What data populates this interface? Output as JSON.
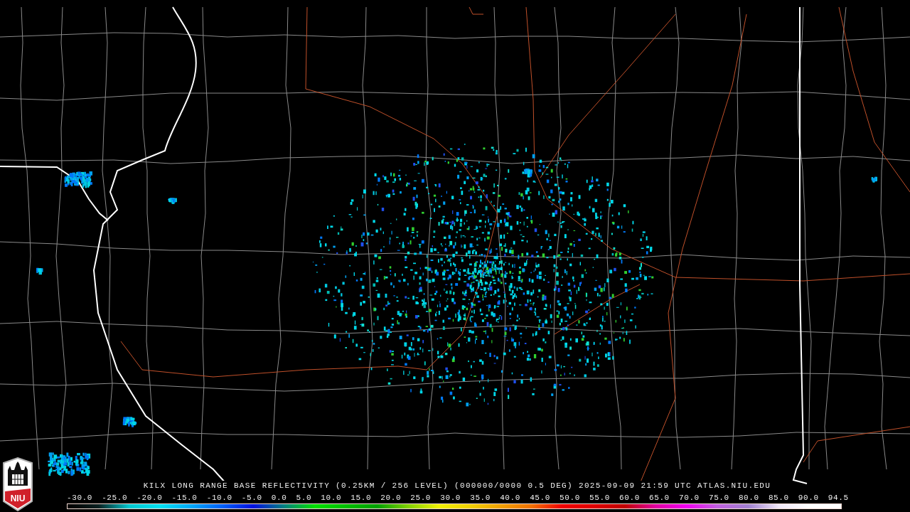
{
  "logo": {
    "text": "NIU"
  },
  "caption": "KILX LONG RANGE BASE REFLECTIVITY (0.25KM / 256 LEVEL) (000000/0000 0.5 DEG) 2025-09-09 21:59 UTC  ATLAS.NIU.EDU",
  "scale_labels": [
    "-30.0",
    "-25.0",
    "-20.0",
    "-15.0",
    "-10.0",
    "-5.0",
    "0.0",
    "5.0",
    "10.0",
    "15.0",
    "20.0",
    "25.0",
    "30.0",
    "35.0",
    "40.0",
    "45.0",
    "50.0",
    "55.0",
    "60.0",
    "65.0",
    "70.0",
    "75.0",
    "80.0",
    "85.0",
    "90.0",
    "94.5"
  ]
}
